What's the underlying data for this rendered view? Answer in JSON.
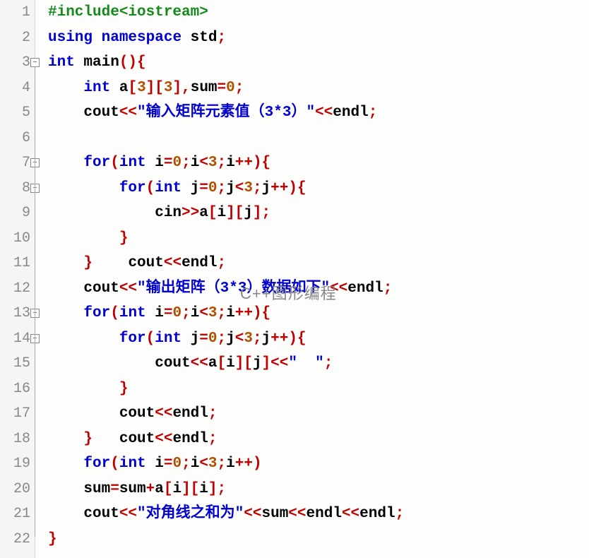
{
  "watermark": "C++图形编程",
  "lines": [
    {
      "num": "1",
      "tokens": [
        {
          "t": "#include<iostream>",
          "c": "pp"
        }
      ]
    },
    {
      "num": "2",
      "tokens": [
        {
          "t": "using",
          "c": "kw"
        },
        {
          "t": " ",
          "c": ""
        },
        {
          "t": "namespace",
          "c": "kw"
        },
        {
          "t": " std",
          "c": ""
        },
        {
          "t": ";",
          "c": "op"
        }
      ]
    },
    {
      "num": "3",
      "fold": true,
      "tokens": [
        {
          "t": "int",
          "c": "kw"
        },
        {
          "t": " main",
          "c": ""
        },
        {
          "t": "(){",
          "c": "op"
        }
      ]
    },
    {
      "num": "4",
      "tokens": [
        {
          "t": "    ",
          "c": ""
        },
        {
          "t": "int",
          "c": "kw"
        },
        {
          "t": " a",
          "c": ""
        },
        {
          "t": "[",
          "c": "op"
        },
        {
          "t": "3",
          "c": "num"
        },
        {
          "t": "][",
          "c": "op"
        },
        {
          "t": "3",
          "c": "num"
        },
        {
          "t": "],",
          "c": "op"
        },
        {
          "t": "sum",
          "c": ""
        },
        {
          "t": "=",
          "c": "op"
        },
        {
          "t": "0",
          "c": "num"
        },
        {
          "t": ";",
          "c": "op"
        }
      ]
    },
    {
      "num": "5",
      "tokens": [
        {
          "t": "    cout",
          "c": ""
        },
        {
          "t": "<<",
          "c": "op"
        },
        {
          "t": "\"输入矩阵元素值（3*3）\"",
          "c": "str"
        },
        {
          "t": "<<",
          "c": "op"
        },
        {
          "t": "endl",
          "c": ""
        },
        {
          "t": ";",
          "c": "op"
        }
      ]
    },
    {
      "num": "6",
      "tokens": [
        {
          "t": " ",
          "c": ""
        }
      ]
    },
    {
      "num": "7",
      "fold": true,
      "tokens": [
        {
          "t": "    ",
          "c": ""
        },
        {
          "t": "for",
          "c": "kw"
        },
        {
          "t": "(",
          "c": "op"
        },
        {
          "t": "int",
          "c": "kw"
        },
        {
          "t": " i",
          "c": ""
        },
        {
          "t": "=",
          "c": "op"
        },
        {
          "t": "0",
          "c": "num"
        },
        {
          "t": ";",
          "c": "op"
        },
        {
          "t": "i",
          "c": ""
        },
        {
          "t": "<",
          "c": "op"
        },
        {
          "t": "3",
          "c": "num"
        },
        {
          "t": ";",
          "c": "op"
        },
        {
          "t": "i",
          "c": ""
        },
        {
          "t": "++){",
          "c": "op"
        }
      ]
    },
    {
      "num": "8",
      "fold": true,
      "tokens": [
        {
          "t": "        ",
          "c": ""
        },
        {
          "t": "for",
          "c": "kw"
        },
        {
          "t": "(",
          "c": "op"
        },
        {
          "t": "int",
          "c": "kw"
        },
        {
          "t": " j",
          "c": ""
        },
        {
          "t": "=",
          "c": "op"
        },
        {
          "t": "0",
          "c": "num"
        },
        {
          "t": ";",
          "c": "op"
        },
        {
          "t": "j",
          "c": ""
        },
        {
          "t": "<",
          "c": "op"
        },
        {
          "t": "3",
          "c": "num"
        },
        {
          "t": ";",
          "c": "op"
        },
        {
          "t": "j",
          "c": ""
        },
        {
          "t": "++){",
          "c": "op"
        }
      ]
    },
    {
      "num": "9",
      "tokens": [
        {
          "t": "            cin",
          "c": ""
        },
        {
          "t": ">>",
          "c": "op"
        },
        {
          "t": "a",
          "c": ""
        },
        {
          "t": "[",
          "c": "op"
        },
        {
          "t": "i",
          "c": ""
        },
        {
          "t": "][",
          "c": "op"
        },
        {
          "t": "j",
          "c": ""
        },
        {
          "t": "];",
          "c": "op"
        }
      ]
    },
    {
      "num": "10",
      "tokens": [
        {
          "t": "        ",
          "c": ""
        },
        {
          "t": "}",
          "c": "op"
        }
      ]
    },
    {
      "num": "11",
      "tokens": [
        {
          "t": "    ",
          "c": ""
        },
        {
          "t": "}",
          "c": "op"
        },
        {
          "t": "    cout",
          "c": ""
        },
        {
          "t": "<<",
          "c": "op"
        },
        {
          "t": "endl",
          "c": ""
        },
        {
          "t": ";",
          "c": "op"
        }
      ]
    },
    {
      "num": "12",
      "tokens": [
        {
          "t": "    cout",
          "c": ""
        },
        {
          "t": "<<",
          "c": "op"
        },
        {
          "t": "\"输出矩阵（3*3）数据如下\"",
          "c": "str"
        },
        {
          "t": "<<",
          "c": "op"
        },
        {
          "t": "endl",
          "c": ""
        },
        {
          "t": ";",
          "c": "op"
        }
      ]
    },
    {
      "num": "13",
      "fold": true,
      "tokens": [
        {
          "t": "    ",
          "c": ""
        },
        {
          "t": "for",
          "c": "kw"
        },
        {
          "t": "(",
          "c": "op"
        },
        {
          "t": "int",
          "c": "kw"
        },
        {
          "t": " i",
          "c": ""
        },
        {
          "t": "=",
          "c": "op"
        },
        {
          "t": "0",
          "c": "num"
        },
        {
          "t": ";",
          "c": "op"
        },
        {
          "t": "i",
          "c": ""
        },
        {
          "t": "<",
          "c": "op"
        },
        {
          "t": "3",
          "c": "num"
        },
        {
          "t": ";",
          "c": "op"
        },
        {
          "t": "i",
          "c": ""
        },
        {
          "t": "++){",
          "c": "op"
        }
      ]
    },
    {
      "num": "14",
      "fold": true,
      "tokens": [
        {
          "t": "        ",
          "c": ""
        },
        {
          "t": "for",
          "c": "kw"
        },
        {
          "t": "(",
          "c": "op"
        },
        {
          "t": "int",
          "c": "kw"
        },
        {
          "t": " j",
          "c": ""
        },
        {
          "t": "=",
          "c": "op"
        },
        {
          "t": "0",
          "c": "num"
        },
        {
          "t": ";",
          "c": "op"
        },
        {
          "t": "j",
          "c": ""
        },
        {
          "t": "<",
          "c": "op"
        },
        {
          "t": "3",
          "c": "num"
        },
        {
          "t": ";",
          "c": "op"
        },
        {
          "t": "j",
          "c": ""
        },
        {
          "t": "++){",
          "c": "op"
        }
      ]
    },
    {
      "num": "15",
      "tokens": [
        {
          "t": "            cout",
          "c": ""
        },
        {
          "t": "<<",
          "c": "op"
        },
        {
          "t": "a",
          "c": ""
        },
        {
          "t": "[",
          "c": "op"
        },
        {
          "t": "i",
          "c": ""
        },
        {
          "t": "][",
          "c": "op"
        },
        {
          "t": "j",
          "c": ""
        },
        {
          "t": "]<<",
          "c": "op"
        },
        {
          "t": "\"  \"",
          "c": "str"
        },
        {
          "t": ";",
          "c": "op"
        }
      ]
    },
    {
      "num": "16",
      "tokens": [
        {
          "t": "        ",
          "c": ""
        },
        {
          "t": "}",
          "c": "op"
        }
      ]
    },
    {
      "num": "17",
      "tokens": [
        {
          "t": "        cout",
          "c": ""
        },
        {
          "t": "<<",
          "c": "op"
        },
        {
          "t": "endl",
          "c": ""
        },
        {
          "t": ";",
          "c": "op"
        }
      ]
    },
    {
      "num": "18",
      "tokens": [
        {
          "t": "    ",
          "c": ""
        },
        {
          "t": "}",
          "c": "op"
        },
        {
          "t": "   cout",
          "c": ""
        },
        {
          "t": "<<",
          "c": "op"
        },
        {
          "t": "endl",
          "c": ""
        },
        {
          "t": ";",
          "c": "op"
        }
      ]
    },
    {
      "num": "19",
      "tokens": [
        {
          "t": "    ",
          "c": ""
        },
        {
          "t": "for",
          "c": "kw"
        },
        {
          "t": "(",
          "c": "op"
        },
        {
          "t": "int",
          "c": "kw"
        },
        {
          "t": " i",
          "c": ""
        },
        {
          "t": "=",
          "c": "op"
        },
        {
          "t": "0",
          "c": "num"
        },
        {
          "t": ";",
          "c": "op"
        },
        {
          "t": "i",
          "c": ""
        },
        {
          "t": "<",
          "c": "op"
        },
        {
          "t": "3",
          "c": "num"
        },
        {
          "t": ";",
          "c": "op"
        },
        {
          "t": "i",
          "c": ""
        },
        {
          "t": "++)",
          "c": "op"
        }
      ]
    },
    {
      "num": "20",
      "tokens": [
        {
          "t": "    sum",
          "c": ""
        },
        {
          "t": "=",
          "c": "op"
        },
        {
          "t": "sum",
          "c": ""
        },
        {
          "t": "+",
          "c": "op"
        },
        {
          "t": "a",
          "c": ""
        },
        {
          "t": "[",
          "c": "op"
        },
        {
          "t": "i",
          "c": ""
        },
        {
          "t": "][",
          "c": "op"
        },
        {
          "t": "i",
          "c": ""
        },
        {
          "t": "];",
          "c": "op"
        }
      ]
    },
    {
      "num": "21",
      "tokens": [
        {
          "t": "    cout",
          "c": ""
        },
        {
          "t": "<<",
          "c": "op"
        },
        {
          "t": "\"对角线之和为\"",
          "c": "str"
        },
        {
          "t": "<<",
          "c": "op"
        },
        {
          "t": "sum",
          "c": ""
        },
        {
          "t": "<<",
          "c": "op"
        },
        {
          "t": "endl",
          "c": ""
        },
        {
          "t": "<<",
          "c": "op"
        },
        {
          "t": "endl",
          "c": ""
        },
        {
          "t": ";",
          "c": "op"
        }
      ]
    },
    {
      "num": "22",
      "tokens": [
        {
          "t": "}",
          "c": "op"
        }
      ]
    }
  ]
}
